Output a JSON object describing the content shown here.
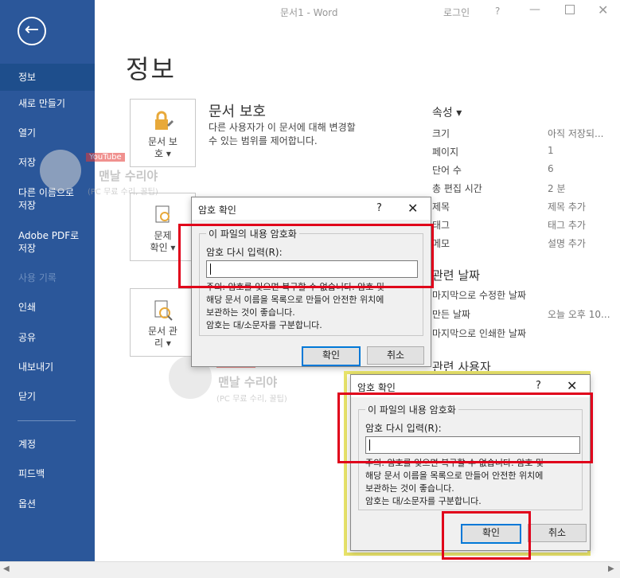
{
  "window": {
    "title": "문서1  -  Word",
    "login": "로그인",
    "help": "?"
  },
  "sidebar": {
    "items": [
      {
        "label": "정보"
      },
      {
        "label": "새로 만들기"
      },
      {
        "label": "열기"
      },
      {
        "label": "저장"
      },
      {
        "label": "다른 이름으로\n저장"
      },
      {
        "label": "Adobe PDF로\n저장"
      },
      {
        "label": "사용 기록"
      },
      {
        "label": "인쇄"
      },
      {
        "label": "공유"
      },
      {
        "label": "내보내기"
      },
      {
        "label": "닫기"
      },
      {
        "label": "계정"
      },
      {
        "label": "피드백"
      },
      {
        "label": "옵션"
      }
    ]
  },
  "main": {
    "title": "정보",
    "protect_btn": "문서 보\n호 ▾",
    "issues_btn": "문제\n확인 ▾",
    "manage_btn": "문서 관\n리 ▾",
    "protect_heading": "문서 보호",
    "protect_desc": "다른 사용자가 이 문서에 대해 변경할\n수 있는 범위를 제어합니다."
  },
  "properties": {
    "heading": "속성 ▾",
    "rows": [
      {
        "label": "크기",
        "value": "아직 저장되..."
      },
      {
        "label": "페이지",
        "value": "1"
      },
      {
        "label": "단어 수",
        "value": "6"
      },
      {
        "label": "총 편집 시간",
        "value": "2 분"
      },
      {
        "label": "제목",
        "value": "제목 추가"
      },
      {
        "label": "태그",
        "value": "태그 추가"
      },
      {
        "label": "메모",
        "value": "설명 추가"
      }
    ],
    "dates_heading": "관련 날짜",
    "dates": [
      {
        "label": "마지막으로 수정한 날짜",
        "value": ""
      },
      {
        "label": "만든 날짜",
        "value": "오늘 오후 10..."
      },
      {
        "label": "마지막으로 인쇄한 날짜",
        "value": ""
      }
    ],
    "people_heading": "관련 사용자"
  },
  "dialog1": {
    "title": "암호 확인",
    "group_label": "이 파일의 내용 암호화",
    "field_label": "암호 다시 입력(R):",
    "warning": "주의: 암호를 잊으면 복구할 수 없습니다. 암호 및\n해당 문서 이름을 목록으로 만들어 안전한 위치에\n보관하는 것이 좋습니다.\n암호는 대/소문자를 구분합니다.",
    "ok": "확인",
    "cancel": "취소"
  },
  "dialog2": {
    "title": "암호 확인",
    "group_label": "이 파일의 내용 암호화",
    "field_label": "암호 다시 입력(R):",
    "warning": "주의: 암호를 잊으면 복구할 수 없습니다. 암호 및\n해당 문서 이름을 목록으로 만들어 안전한 위치에\n보관하는 것이 좋습니다.\n암호는 대/소문자를 구분합니다.",
    "ok": "확인",
    "cancel": "취소"
  },
  "watermark": {
    "channel": "맨날 수리야",
    "sub": "(PC 무료 수리, 꿀팁)",
    "badge": "YouTube"
  },
  "colors": {
    "sidebar": "#2b579a",
    "highlight": "#e0001a",
    "glow": "#e8e36a"
  }
}
